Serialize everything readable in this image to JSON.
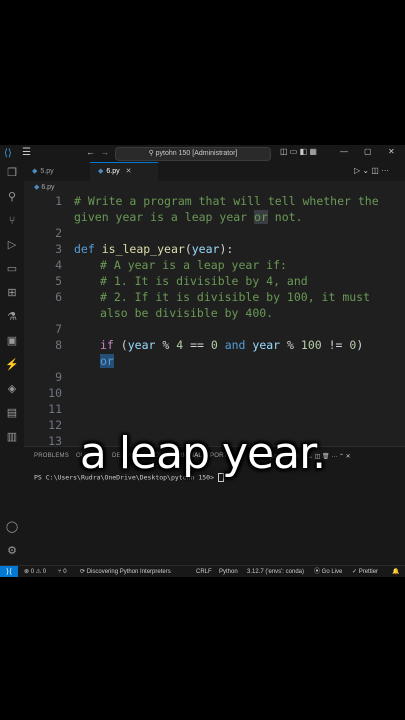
{
  "titlebar": {
    "menu_icon": "☰",
    "back": "←",
    "forward": "→",
    "search": "⚲ pytohn 150 [Administrator]",
    "layout_icons": "◫ ▭ ◧ ▦",
    "minimize": "—",
    "maximize": "▢",
    "close": "✕"
  },
  "tabs": [
    {
      "label": "5.py",
      "active": false
    },
    {
      "label": "6.py",
      "active": true
    }
  ],
  "tab_actions": "▷ ⌄ ◫ ···",
  "breadcrumb": "6.py",
  "editor": {
    "line_numbers": [
      "1",
      "",
      "2",
      "3",
      "4",
      "5",
      "6",
      "",
      "7",
      "8",
      "",
      "9",
      "10",
      "11",
      "12",
      "13"
    ],
    "l1a": "# Write a program that will tell whether the",
    "l1b_pre": "given year is a leap year ",
    "l1b_hl": "or",
    "l1b_post": " not.",
    "l3_def": "def",
    "l3_fn": "is_leap_year",
    "l3_open": "(",
    "l3_param": "year",
    "l3_close": "):",
    "l4": "# A year is a leap year if:",
    "l5": "# 1. It is divisible by 4, and",
    "l6a": "# 2. If it is divisible by 100, it must",
    "l6b": "also be divisible by 400.",
    "l8_if": "if",
    "l8_a": " (",
    "l8_year1": "year",
    "l8_b": " % ",
    "l8_n4": "4",
    "l8_c": " == ",
    "l8_n0": "0",
    "l8_and": " and ",
    "l8_year2": "year",
    "l8_d": " % ",
    "l8_n100": "100",
    "l8_e": " != ",
    "l8_n0b": "0",
    "l8_f": ")",
    "l8b_or": "or"
  },
  "panel": {
    "tabs": [
      "PROBLEMS",
      "OUTPUT",
      "DEBUG CONSOLE",
      "TERMINAL",
      "PORTS"
    ],
    "right_icons": "powershell ＋ ⌄ ◫ 🗑 ··· ⌃ ✕",
    "terminal_line": "PS C:\\Users\\Rudra\\OneDrive\\Desktop\\pytohn 150> "
  },
  "status": {
    "remote": "⟩⟨",
    "errors": "⊗ 0 ⚠ 0",
    "ports": "⑂ 0",
    "discovering": "⟳ Discovering Python Interpreters",
    "eol": "CRLF",
    "language": "Python",
    "interpreter": "3.12.7 ('envs': conda)",
    "golive": "⦿ Go Live",
    "prettier": "✓ Prettier",
    "bell": "🔔"
  },
  "caption": "a leap year."
}
